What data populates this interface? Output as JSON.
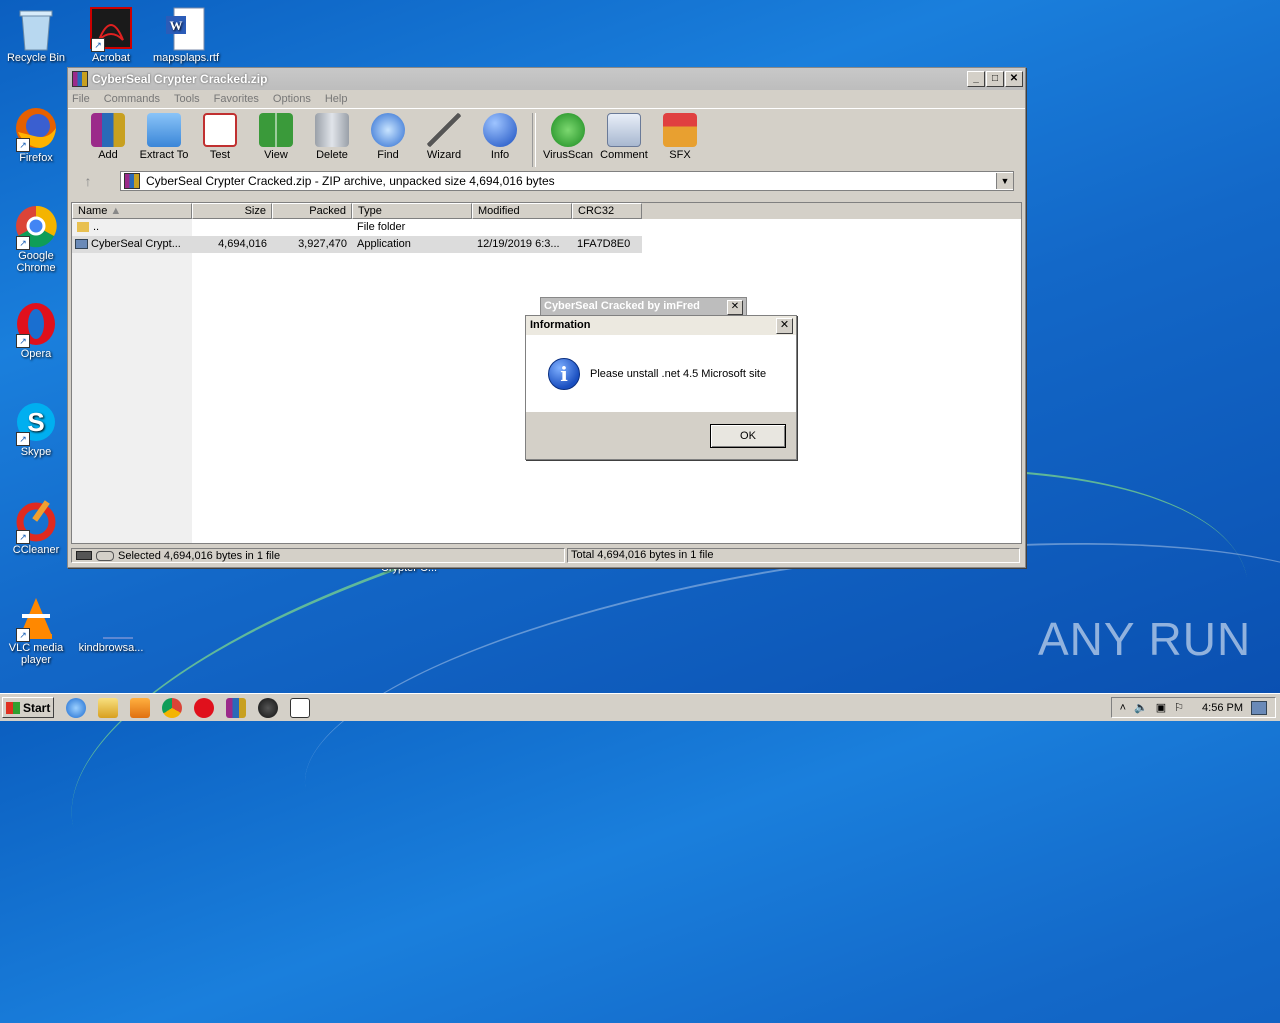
{
  "desktop": {
    "icons": [
      {
        "label": "Recycle Bin"
      },
      {
        "label": "Acrobat"
      },
      {
        "label": "mapsplaps.rtf"
      },
      {
        "label": "Firefox"
      },
      {
        "label": "Google Chrome"
      },
      {
        "label": "Opera"
      },
      {
        "label": "Skype"
      },
      {
        "label": "CCleaner"
      },
      {
        "label": "VLC media player"
      },
      {
        "label": "kindbrowsa..."
      },
      {
        "label": "Crypter C..."
      }
    ]
  },
  "window": {
    "title": "CyberSeal Crypter Cracked.zip",
    "menu": [
      "File",
      "Commands",
      "Tools",
      "Favorites",
      "Options",
      "Help"
    ],
    "toolbar": [
      "Add",
      "Extract To",
      "Test",
      "View",
      "Delete",
      "Find",
      "Wizard",
      "Info",
      "VirusScan",
      "Comment",
      "SFX"
    ],
    "address": "CyberSeal Crypter Cracked.zip - ZIP archive, unpacked size 4,694,016 bytes",
    "columns": [
      "Name",
      "Size",
      "Packed",
      "Type",
      "Modified",
      "CRC32"
    ],
    "rows": [
      {
        "name": "..",
        "size": "",
        "packed": "",
        "type": "File folder",
        "modified": "",
        "crc": ""
      },
      {
        "name": "CyberSeal Crypt...",
        "size": "4,694,016",
        "packed": "3,927,470",
        "type": "Application",
        "modified": "12/19/2019 6:3...",
        "crc": "1FA7D8E0"
      }
    ],
    "status_left": "Selected 4,694,016 bytes in 1 file",
    "status_right": "Total 4,694,016 bytes in 1 file"
  },
  "bg_dialog": {
    "title": "CyberSeal Cracked by imFred"
  },
  "dialog": {
    "title": "Information",
    "message": "Please unstall .net 4.5 Microsoft site",
    "ok": "OK"
  },
  "taskbar": {
    "start": "Start",
    "time": "4:56 PM"
  },
  "watermark": "ANY RUN",
  "colors": {
    "desktop": "#1a7fdc",
    "window": "#d4d0c8",
    "selection": "#dcdcdc"
  }
}
